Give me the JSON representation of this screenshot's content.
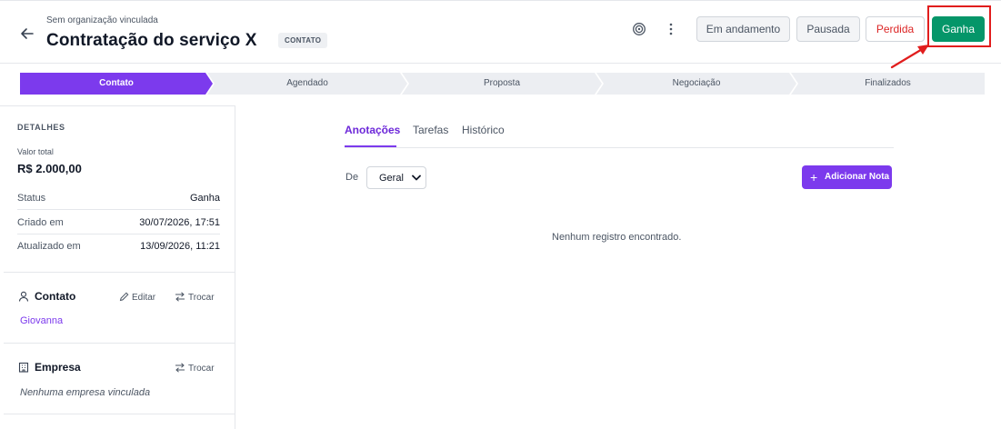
{
  "header": {
    "organization": "Sem organização vinculada",
    "title": "Contratação do serviço X",
    "stage_badge": "CONTATO",
    "status_buttons": {
      "in_progress": "Em andamento",
      "paused": "Pausada",
      "lost": "Perdida",
      "won": "Ganha"
    },
    "icons": [
      "back-arrow-icon",
      "target-icon",
      "more-vertical-icon"
    ]
  },
  "pipeline": {
    "stages": [
      "Contato",
      "Agendado",
      "Proposta",
      "Negociação",
      "Finalizados"
    ],
    "active_index": 0
  },
  "details": {
    "heading": "DETALHES",
    "total_label": "Valor total",
    "total_value": "R$ 2.000,00",
    "rows": [
      {
        "label": "Status",
        "value": "Ganha"
      },
      {
        "label": "Criado em",
        "value": "30/07/2026, 17:51"
      },
      {
        "label": "Atualizado em",
        "value": "13/09/2026, 11:21"
      }
    ]
  },
  "contact": {
    "title": "Contato",
    "edit_label": "Editar",
    "swap_label": "Trocar",
    "name": "Giovanna"
  },
  "company": {
    "title": "Empresa",
    "swap_label": "Trocar",
    "empty": "Nenhuma empresa vinculada"
  },
  "main": {
    "tabs": [
      "Anotações",
      "Tarefas",
      "Histórico"
    ],
    "active_tab": "Anotações",
    "filter_label": "De",
    "filter_value": "Geral",
    "add_note_label": "Adicionar Nota",
    "empty_message": "Nenhum registro encontrado."
  },
  "colors": {
    "accent": "#7c3aed",
    "won": "#059669",
    "lost": "#dc2626",
    "annotation": "#e11d1d"
  }
}
